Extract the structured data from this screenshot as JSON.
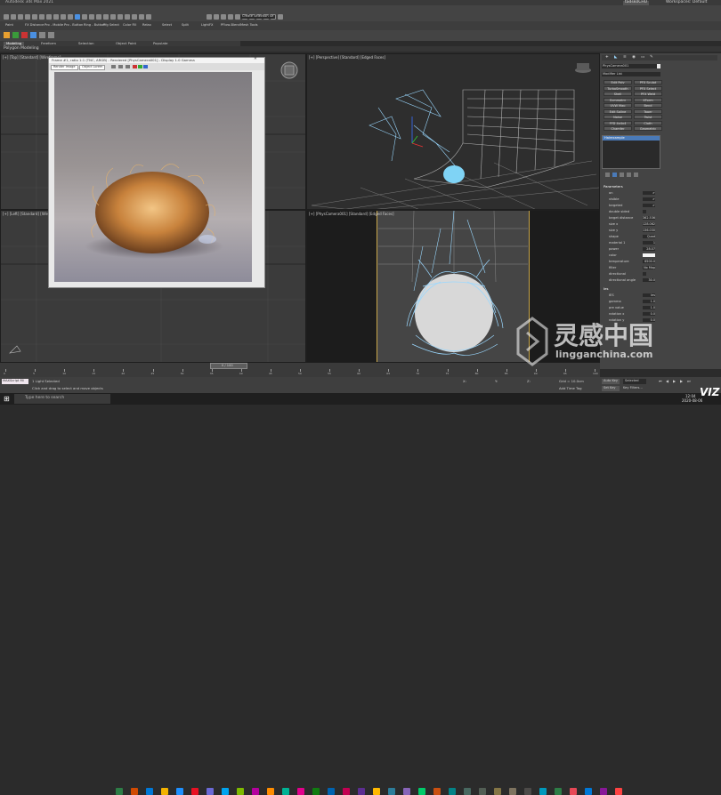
{
  "app": {
    "title": "Autodesk 3ds Max 2021",
    "colors": {
      "accent": "#1e90ff",
      "selection": "#9ad8ff",
      "wire": "#b8b8b8",
      "hair": "#c8823c"
    }
  },
  "titlebar": {
    "title": "Autodesk 3ds Max 2021",
    "user": "tadsk0CHU",
    "workspace": "Workspaces: Default"
  },
  "menu": [
    "File",
    "Edit",
    "Tools",
    "Group",
    "Views",
    "Create",
    "Modifiers",
    "Animation",
    "Graph Editors",
    "Rendering",
    "Civil View",
    "Customize",
    "Scripting",
    "Interactive",
    "Content",
    "Arnold",
    "Help",
    "Ornatrix",
    "Substance",
    "Arnold",
    "Octane"
  ],
  "toolbar": {
    "selection_set": "Create Selection Se",
    "view_dropdown": "View"
  },
  "plugin_bar": [
    "Paint",
    "FX Distance",
    "Pro - Mobile",
    "Pro - Button",
    "Ring - Button",
    "Pfg Select",
    "Color Fill",
    "Relax",
    "Select",
    "Split",
    "LightFX",
    "PFlow-Blend",
    "Mesh Tools"
  ],
  "ribbon": {
    "tabs": [
      "Modeling",
      "Freeform",
      "Selection",
      "Object Paint",
      "Populate"
    ],
    "sub": "Polygon Modeling"
  },
  "viewports": {
    "top_left": "[+] [Top] [Standard] [Wireframe]",
    "top_right": "[+] [Perspective] [Standard] [Edged Faces]",
    "bottom_left": "[+] [Left] [Standard] [Wireframe]",
    "bottom_right": "[+] [PhysCamera001] [Standard] [Edged Faces]"
  },
  "frame_window": {
    "title": "Frame #1, ratio 1:1 (TNC, ARGB) - Rendered [PhysCamera001] - Display 1.0 Gamma",
    "toolbar_items": [
      "Render Image",
      "Object Lorem"
    ],
    "statusbar": ""
  },
  "command_panel": {
    "object_name": "PhysCamera001",
    "modifier_list": "Modifier List",
    "buttons": [
      "Edit Poly",
      "PFX Sculpt",
      "TurboSmooth",
      "PFX Select",
      "Shell",
      "PFX Weld",
      "Symmetry",
      "XForm",
      "UVW Map",
      "Bend",
      "Edit Spline",
      "Taper",
      "Noise",
      "Twist",
      "FFD 4x4x4",
      "Cloth",
      "Chamfer",
      "Geometric"
    ],
    "stack_item": "Hairexample",
    "section": "Parameters",
    "params": [
      {
        "label": "on",
        "value": "✔"
      },
      {
        "label": "visible",
        "value": "✔"
      },
      {
        "label": "targeted",
        "value": "✔"
      },
      {
        "label": "double sided",
        "value": ""
      },
      {
        "label": "target distance",
        "value": "362.536"
      },
      {
        "label": "size x",
        "value": "128.062"
      },
      {
        "label": "size y",
        "value": "136.030"
      },
      {
        "label": "shape",
        "value": "Quad"
      },
      {
        "label": "material 1",
        "value": "1"
      },
      {
        "label": "power",
        "value": "28.07"
      },
      {
        "label": "color",
        "value": ""
      },
      {
        "label": "temperature",
        "value": "6500.0"
      },
      {
        "label": "filter",
        "value": "No Map"
      },
      {
        "label": "directional",
        "value": ""
      },
      {
        "label": "directional angle",
        "value": "30.0"
      }
    ],
    "section2": "Ies",
    "params2": [
      {
        "label": "IES",
        "value": "Ies"
      },
      {
        "label": "gamma",
        "value": "1.0"
      },
      {
        "label": "pre value",
        "value": "1.0"
      },
      {
        "label": "rotation x",
        "value": "0.0"
      },
      {
        "label": "rotation y",
        "value": "0.0"
      }
    ]
  },
  "timeline": {
    "frame": "0 / 100",
    "ticks": [
      "0",
      "5",
      "10",
      "15",
      "20",
      "25",
      "30",
      "35",
      "40",
      "45",
      "50",
      "55",
      "60",
      "65",
      "70",
      "75",
      "80",
      "85",
      "90",
      "95",
      "100"
    ]
  },
  "status": {
    "script_label": "MAXScript Mi",
    "selection": "1 Light Selected",
    "hint": "Click and drag to select and move objects",
    "x": "X:",
    "y": "Y:",
    "z": "Z:",
    "grid": "Grid = 10.0cm",
    "add_time_tag": "Add Time Tag",
    "autokey": "Auto Key",
    "selected": "Selected",
    "setkey": "Set Key",
    "key_filters": "Key Filters..."
  },
  "taskbar": {
    "search": "Type here to search",
    "time": "12:04",
    "date": "2020-08-06"
  },
  "watermark": {
    "brand": "灵感中国",
    "site": "lingganchina.com",
    "corner": "VIZ"
  }
}
